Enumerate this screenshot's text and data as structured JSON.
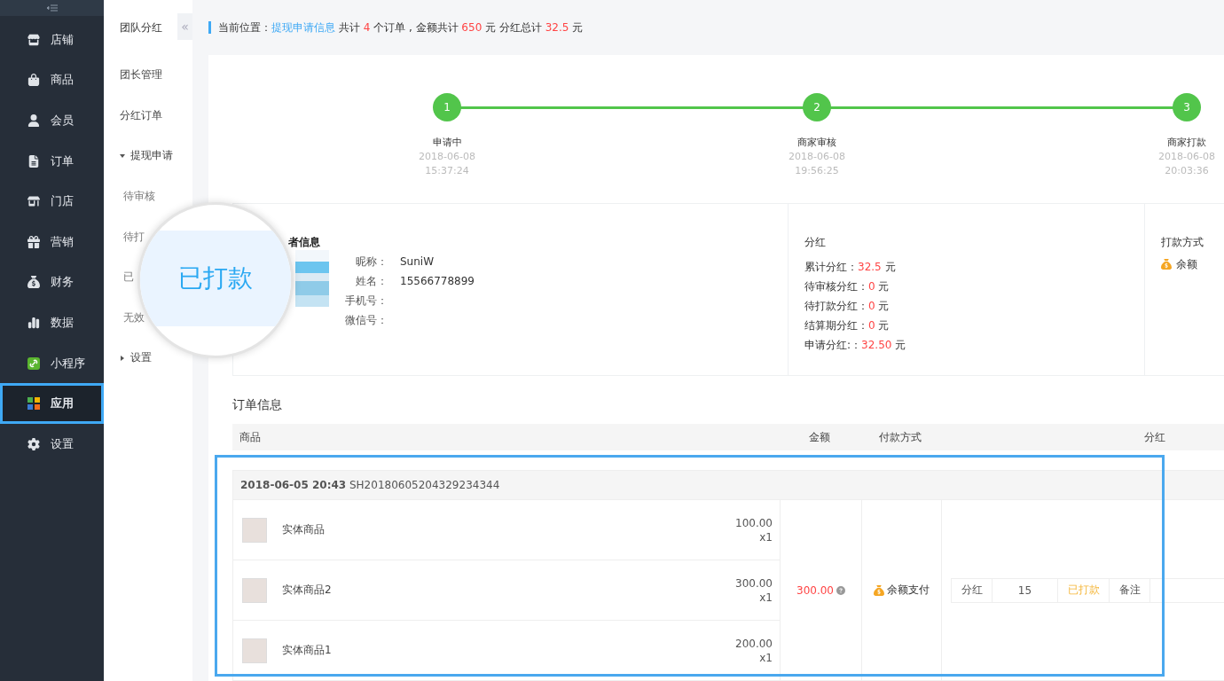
{
  "sidebar": {
    "items": [
      {
        "label": "店铺",
        "selected": false
      },
      {
        "label": "商品",
        "selected": false
      },
      {
        "label": "会员",
        "selected": false
      },
      {
        "label": "订单",
        "selected": false
      },
      {
        "label": "门店",
        "selected": false
      },
      {
        "label": "营销",
        "selected": false
      },
      {
        "label": "财务",
        "selected": false
      },
      {
        "label": "数据",
        "selected": false
      },
      {
        "label": "小程序",
        "selected": false
      },
      {
        "label": "应用",
        "selected": true
      },
      {
        "label": "设置",
        "selected": false
      }
    ]
  },
  "subnav": {
    "title": "团队分红",
    "collapse": "«",
    "items": [
      {
        "label": "团长管理",
        "kind": "link"
      },
      {
        "label": "分红订单",
        "kind": "link"
      },
      {
        "label": "提现申请",
        "kind": "group",
        "expanded": true,
        "children": [
          {
            "label": "待审核"
          },
          {
            "label": "待打"
          },
          {
            "label": "已"
          },
          {
            "label": "无效"
          }
        ]
      },
      {
        "label": "设置",
        "kind": "group",
        "expanded": false
      }
    ]
  },
  "breadcrumb": [
    {
      "kind": "plain",
      "text": "当前位置："
    },
    {
      "kind": "link",
      "text": "提现申请信息"
    },
    {
      "kind": "plain",
      "text": " 共计 "
    },
    {
      "kind": "number",
      "text": "4"
    },
    {
      "kind": "plain",
      "text": " 个订单 , 金额共计 "
    },
    {
      "kind": "number",
      "text": "650"
    },
    {
      "kind": "plain",
      "text": " 元 分红总计 "
    },
    {
      "kind": "number",
      "text": "32.5"
    },
    {
      "kind": "plain",
      "text": " 元"
    }
  ],
  "steps": [
    {
      "number": "1",
      "label": "申请中",
      "date": "2018-06-08",
      "time": "15:37:24",
      "done": true
    },
    {
      "number": "2",
      "label": "商家审核",
      "date": "2018-06-08",
      "time": "19:56:25",
      "done": true
    },
    {
      "number": "3",
      "label": "商家打款",
      "date": "2018-06-08",
      "time": "20:03:36",
      "done": true
    }
  ],
  "applicant": {
    "title": "者信息",
    "fields": [
      {
        "label": "昵称：",
        "value": "SuniW"
      },
      {
        "label": "姓名：",
        "value": "15566778899"
      },
      {
        "label": "手机号："
      },
      {
        "label": "微信号："
      }
    ]
  },
  "dividend": {
    "title": "分红",
    "lines": [
      {
        "label": "累计分红：",
        "value": "32.5",
        "unit": "元"
      },
      {
        "label": "待审核分红：",
        "value": "0",
        "unit": "元"
      },
      {
        "label": "待打款分红：",
        "value": "0",
        "unit": "元"
      },
      {
        "label": "结算期分红：",
        "value": "0",
        "unit": "元"
      },
      {
        "label": "申请分红:：",
        "value": "32.50",
        "unit": "元"
      }
    ]
  },
  "payout": {
    "title": "打款方式",
    "method": "余额"
  },
  "orders": {
    "title": "订单信息",
    "columns": [
      "商品",
      "金额",
      "付款方式",
      "分红"
    ],
    "list": [
      {
        "datetime": "2018-06-05 20:43",
        "number": "SH20180605204329234344",
        "items": [
          {
            "name": "实体商品",
            "price": "100.00",
            "qty": "x1"
          },
          {
            "name": "实体商品2",
            "price": "300.00",
            "qty": "x1"
          },
          {
            "name": "实体商品1",
            "price": "200.00",
            "qty": "x1"
          }
        ],
        "amount": "300.00",
        "payment": "余额支付",
        "dividend": {
          "label": "分红",
          "value": "15",
          "status": "已打款",
          "note": "备注"
        }
      }
    ]
  },
  "magnifier": {
    "text": "已打款"
  }
}
